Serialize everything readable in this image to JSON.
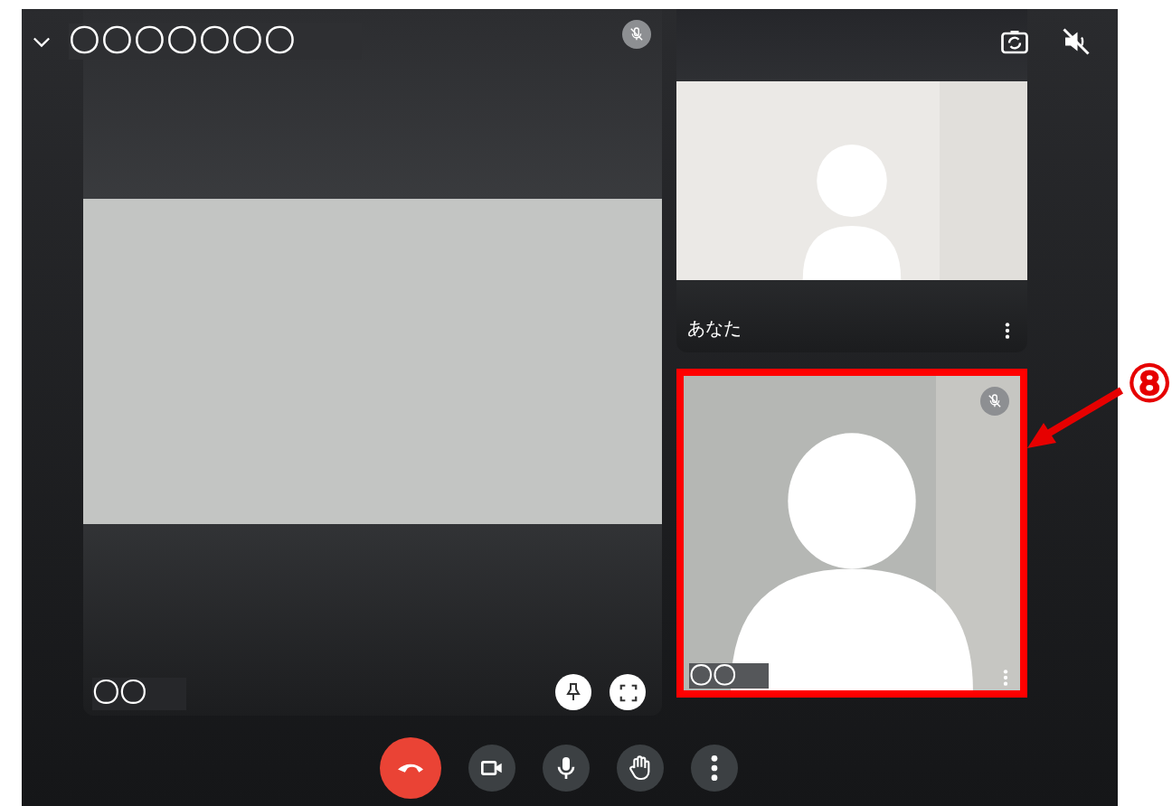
{
  "header": {
    "title": "〇〇〇〇〇〇〇"
  },
  "main_tile": {
    "name": "〇〇",
    "muted": true
  },
  "tiles": [
    {
      "name": "あなた",
      "muted": false,
      "highlighted": false
    },
    {
      "name": "〇〇",
      "muted": true,
      "highlighted": true
    }
  ],
  "controls": [
    {
      "kind": "end-call"
    },
    {
      "kind": "camera"
    },
    {
      "kind": "mic"
    },
    {
      "kind": "hand"
    },
    {
      "kind": "more"
    }
  ],
  "annotation": {
    "label": "⑧"
  }
}
